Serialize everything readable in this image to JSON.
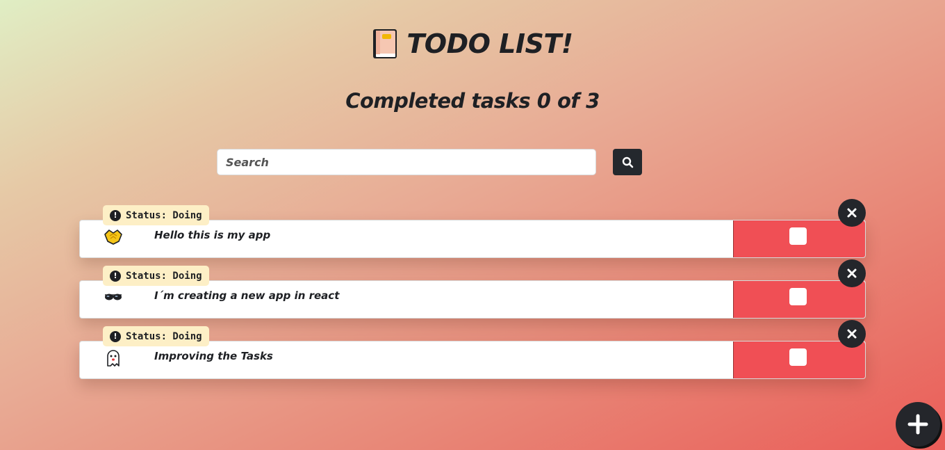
{
  "header": {
    "title": "TODO LIST!",
    "title_icon": "notebook-icon",
    "counter_text": "Completed tasks 0 of 3"
  },
  "search": {
    "placeholder": "Search",
    "value": "",
    "button_icon": "search-icon"
  },
  "todos": [
    {
      "status_label": "Status: Doing",
      "text": "Hello this is my app",
      "emoji": "handshake-icon",
      "completed": false
    },
    {
      "status_label": "Status: Doing",
      "text": "I´m creating a new app in react",
      "emoji": "sunglasses-icon",
      "completed": false
    },
    {
      "status_label": "Status: Doing",
      "text": "Improving the Tasks",
      "emoji": "ghost-icon",
      "completed": false
    }
  ],
  "add_button_icon": "plus-icon",
  "colors": {
    "accent_red": "#f04f55",
    "dark": "#24262b",
    "badge": "#fdefc6"
  }
}
